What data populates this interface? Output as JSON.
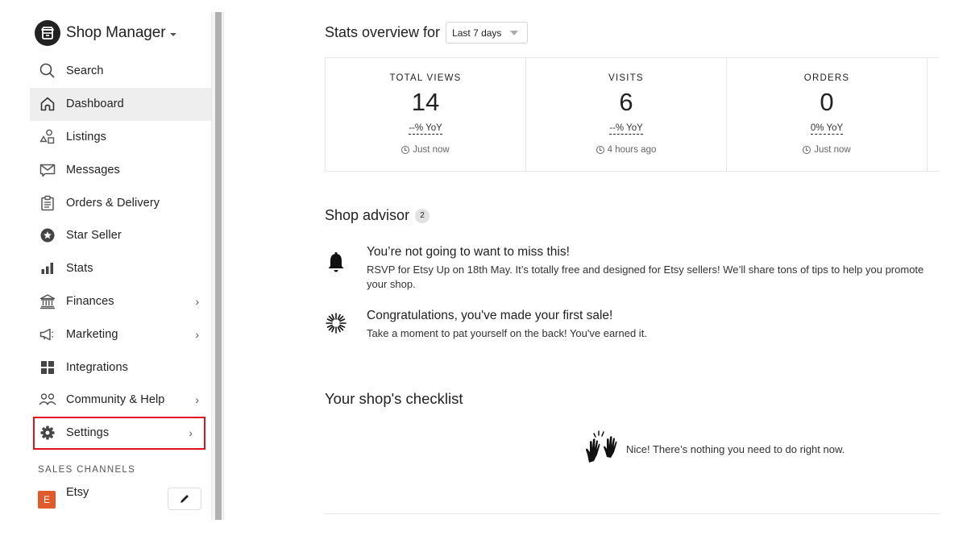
{
  "sidebar": {
    "brand_title": "Shop Manager",
    "items": [
      {
        "label": "Search",
        "icon": "search-icon",
        "has_chevron": false
      },
      {
        "label": "Dashboard",
        "icon": "home-icon",
        "has_chevron": false,
        "active": true
      },
      {
        "label": "Listings",
        "icon": "shapes-icon",
        "has_chevron": false
      },
      {
        "label": "Messages",
        "icon": "message-icon",
        "has_chevron": false
      },
      {
        "label": "Orders & Delivery",
        "icon": "clipboard-icon",
        "has_chevron": false
      },
      {
        "label": "Star Seller",
        "icon": "star-badge-icon",
        "has_chevron": false
      },
      {
        "label": "Stats",
        "icon": "bar-chart-icon",
        "has_chevron": false
      },
      {
        "label": "Finances",
        "icon": "bank-icon",
        "has_chevron": true
      },
      {
        "label": "Marketing",
        "icon": "megaphone-icon",
        "has_chevron": true
      },
      {
        "label": "Integrations",
        "icon": "grid-icon",
        "has_chevron": false
      },
      {
        "label": "Community & Help",
        "icon": "people-icon",
        "has_chevron": true
      },
      {
        "label": "Settings",
        "icon": "gear-icon",
        "has_chevron": true,
        "highlighted": true
      }
    ],
    "chevron": "›",
    "sales_channels_label": "SALES CHANNELS",
    "channel": {
      "badge": "E",
      "name": "Etsy"
    }
  },
  "stats": {
    "title": "Stats overview for",
    "range": "Last 7 days",
    "cards": [
      {
        "label": "TOTAL VIEWS",
        "value": "14",
        "yoy": "--% YoY",
        "time": "Just now"
      },
      {
        "label": "VISITS",
        "value": "6",
        "yoy": "--% YoY",
        "time": "4 hours ago"
      },
      {
        "label": "ORDERS",
        "value": "0",
        "yoy": "0% YoY",
        "time": "Just now"
      }
    ]
  },
  "advisor": {
    "title": "Shop advisor",
    "count": "2",
    "items": [
      {
        "title": "You’re not going to want to miss this!",
        "body": "RSVP for Etsy Up on 18th May. It’s totally free and designed for Etsy sellers! We’ll share tons of tips to help you promote your shop.",
        "icon": "bell-icon"
      },
      {
        "title": "Congratulations, you've made your first sale!",
        "body": "Take a moment to pat yourself on the back! You've earned it.",
        "icon": "sparkle-icon"
      }
    ]
  },
  "checklist": {
    "title": "Your shop's checklist",
    "empty_message": "Nice! There’s nothing you need to do right now."
  },
  "colors": {
    "highlight": "#e0141e",
    "channel_badge": "#e05a2b",
    "active_bg": "#eeeeee"
  }
}
